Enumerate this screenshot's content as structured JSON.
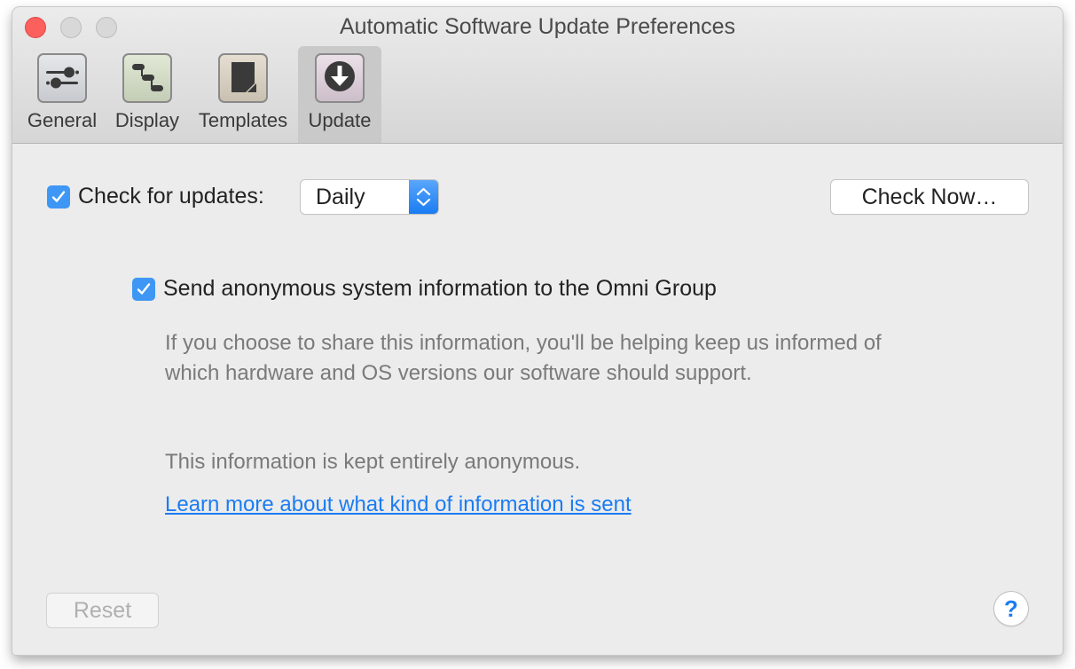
{
  "window": {
    "title": "Automatic Software Update Preferences",
    "controls": [
      "close",
      "minimize",
      "zoom"
    ]
  },
  "toolbar": {
    "tabs": [
      {
        "label": "General",
        "icon": "sliders-icon",
        "selected": false
      },
      {
        "label": "Display",
        "icon": "outline-hierarchy-icon",
        "selected": false
      },
      {
        "label": "Templates",
        "icon": "document-page-icon",
        "selected": false
      },
      {
        "label": "Update",
        "icon": "download-arrow-icon",
        "selected": true
      }
    ]
  },
  "update": {
    "check_for_updates": {
      "label": "Check for updates:",
      "checked": true
    },
    "frequency": {
      "value": "Daily"
    },
    "check_now_label": "Check Now…",
    "send_info": {
      "label": "Send anonymous system information to the Omni Group",
      "checked": true
    },
    "description": "If you choose to share this information, you'll be helping keep us informed of which hardware and OS versions our software should support.",
    "anonymous_note": "This information is kept entirely anonymous.",
    "learn_more_link": "Learn more about what kind of information is sent",
    "reset_label": "Reset",
    "help_label": "?"
  },
  "colors": {
    "accent": "#3e97f5",
    "link": "#1a7cf2",
    "close_button": "#fc605c"
  }
}
